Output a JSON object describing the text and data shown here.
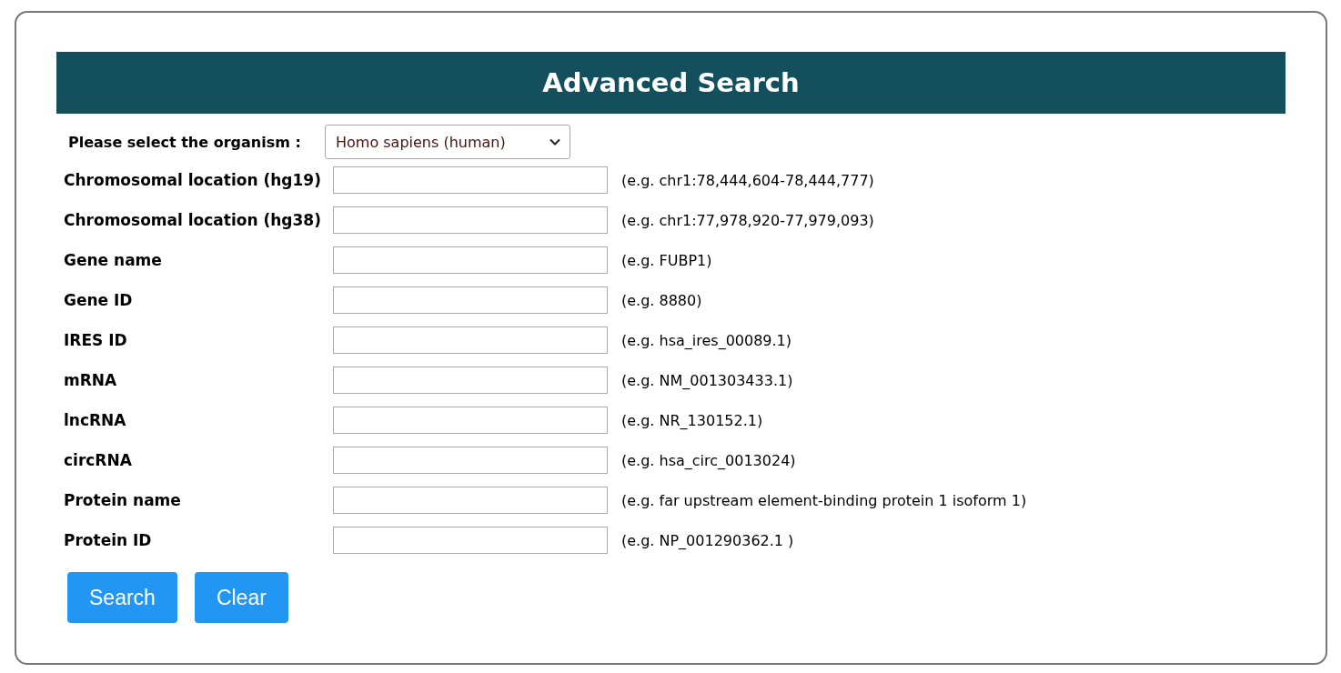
{
  "title": "Advanced Search",
  "organism": {
    "label": "Please select the organism :",
    "value": "Homo sapiens (human)"
  },
  "fields": [
    {
      "label": "Chromosomal location (hg19)",
      "hint": "(e.g. chr1:78,444,604-78,444,777)"
    },
    {
      "label": "Chromosomal location (hg38)",
      "hint": "(e.g. chr1:77,978,920-77,979,093)"
    },
    {
      "label": "Gene name",
      "hint": "(e.g. FUBP1)"
    },
    {
      "label": "Gene ID",
      "hint": "(e.g. 8880)"
    },
    {
      "label": "IRES ID",
      "hint": "(e.g. hsa_ires_00089.1)"
    },
    {
      "label": "mRNA",
      "hint": "(e.g. NM_001303433.1)"
    },
    {
      "label": "lncRNA",
      "hint": "(e.g. NR_130152.1)"
    },
    {
      "label": "circRNA",
      "hint": "(e.g. hsa_circ_0013024)"
    },
    {
      "label": "Protein name",
      "hint": "(e.g. far upstream element-binding protein 1 isoform 1)"
    },
    {
      "label": "Protein ID",
      "hint": "(e.g. NP_001290362.1 )"
    }
  ],
  "buttons": [
    "Search",
    "Clear"
  ]
}
